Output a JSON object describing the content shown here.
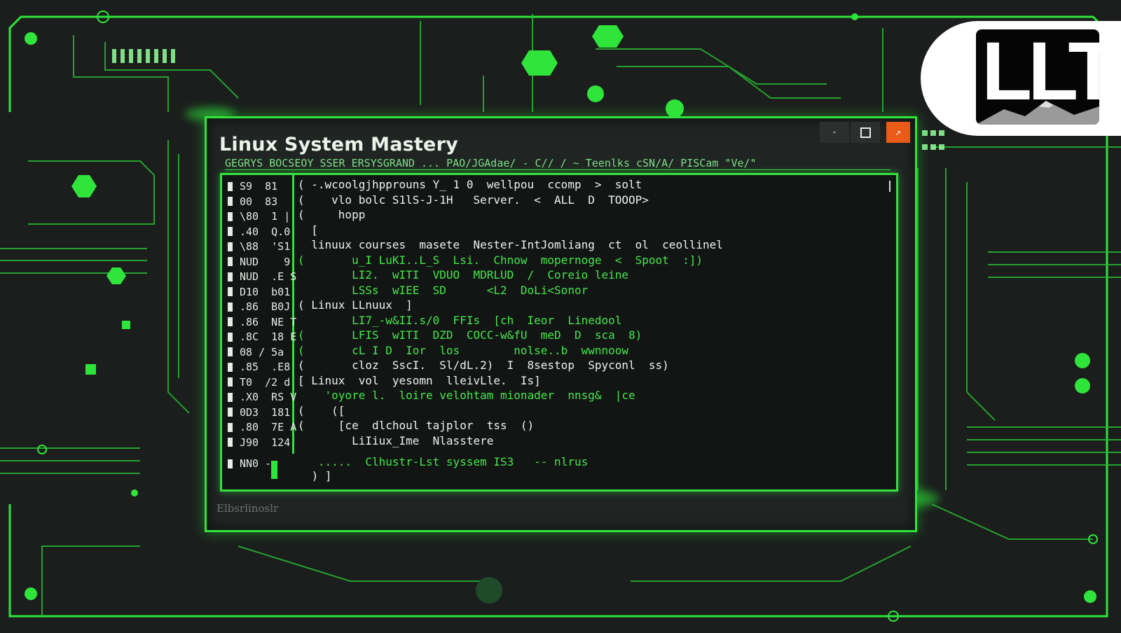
{
  "window": {
    "title": "Linux System Mastery",
    "path": "GEGRYS BOCSEOY SSER ERSYSGRAND ... PAO/JGAdae/ - C// / ~ Teenlks cSN/A/ PISCam \"Ve/\"",
    "controls": {
      "minimize": "-",
      "close": "↗"
    },
    "status": "Elbsrlinoslr"
  },
  "terminal": {
    "gutter": [
      "S9  81",
      "00  83",
      "\\80  1 |",
      ".40  Q.0",
      "\\88  'S1",
      "NUD    9",
      "NUD  .E S",
      "D10  b01",
      ".86  B0J",
      ".86  NE T",
      ".8C  18 E",
      "08 / 5a",
      ".85  .E8",
      "T0  /2 d",
      ".X0  RS V",
      "0D3  181",
      ".80  7E A",
      "J90  124"
    ],
    "gutter_footer": "NN0 -",
    "lines": [
      {
        "text": "( -.wcoolgjhpprouns Y_ 1 0  wellpou  ccomp  >  solt",
        "style": "w"
      },
      {
        "text": "(    vlo bolc S1lS-J-1H   Server.  <  ALL  D  TOOOP>",
        "style": "w"
      },
      {
        "text": "(     hopp",
        "style": "w"
      },
      {
        "text": "  [",
        "style": "w"
      },
      {
        "text": "  linuux courses  masete  Nester-IntJomliang  ct  ol  ceollinel",
        "style": "w"
      },
      {
        "text": "(       u_I LuKI..L_S  Lsi.  Chnow  mopernoge  <  Spoot  :])",
        "style": "g"
      },
      {
        "text": "        LI2.  wITI  VDUO  MDRLUD  /  Coreio leine",
        "style": "g"
      },
      {
        "text": "        LSSs  wIEE  SD      <L2  DoLi<Sonor",
        "style": "g"
      },
      {
        "text": "( Linux LLnuux  ]",
        "style": "w"
      },
      {
        "text": "        LI7_-w&II.s/0  FFIs  [ch  Ieor  Linedool",
        "style": "g"
      },
      {
        "text": "(       LFIS  wITI  DZD  COCC-w&fU  meD  D  sca  8)",
        "style": "g"
      },
      {
        "text": "(       cL I D  Ior  los        nolse..b  wwnnoow",
        "style": "g"
      },
      {
        "text": "(       cloz  SscI.  Sl/dL.2)  I  8sestop  Spyconl  ss)",
        "style": "w"
      },
      {
        "text": "[ Linux  vol  yesomn  lleivLle.  Is]",
        "style": "w"
      },
      {
        "text": "    'oyore l.  loire velohtam mionader  nnsg&  |ce",
        "style": "g"
      },
      {
        "text": "(    ([",
        "style": "w"
      },
      {
        "text": "(     [ce  dlchoul tajplor  tss  ()",
        "style": "w"
      },
      {
        "text": "        LiIiux_Ime  Nlasstere",
        "style": "w"
      }
    ],
    "footer_line": "   .....  Clhustr-Lst syssem IS3   -- nlrus",
    "closing": " ) ]"
  },
  "logo": {
    "text": "LLT"
  },
  "colors": {
    "neon": "#2fe43a",
    "background": "#1b1e1d",
    "close_button": "#ea5a18"
  }
}
